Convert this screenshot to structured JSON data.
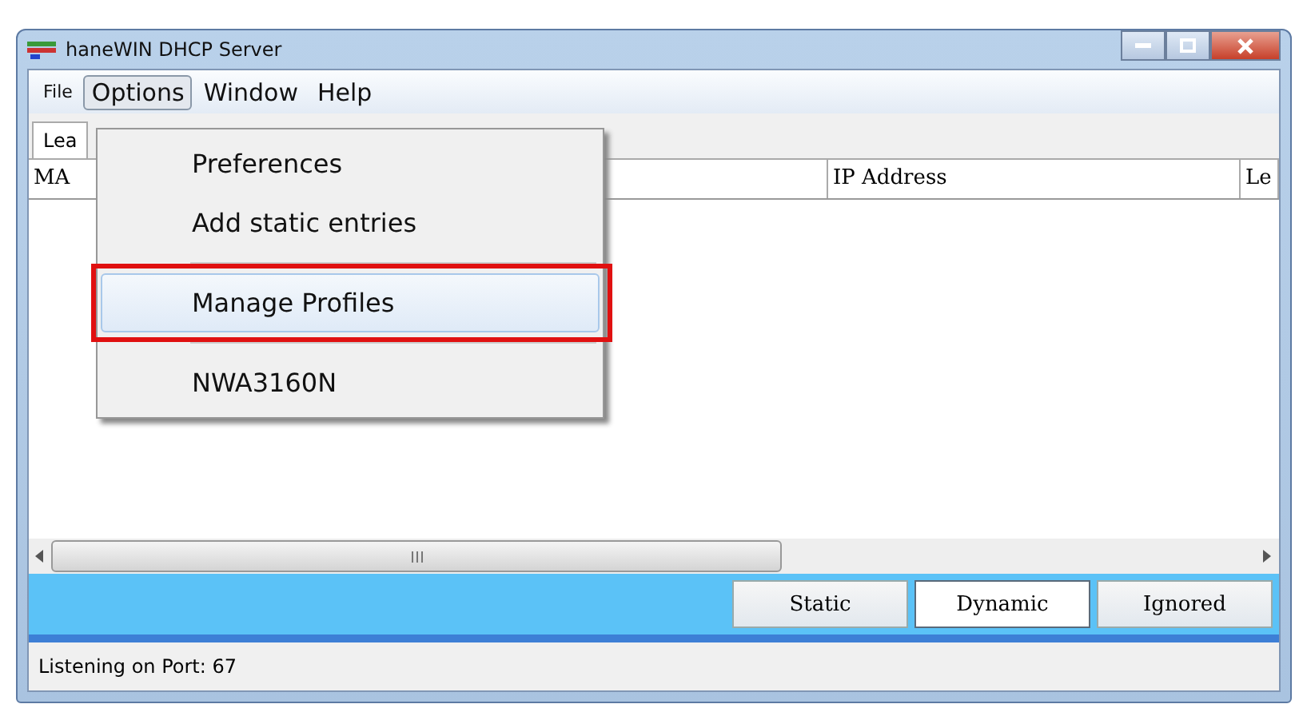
{
  "window": {
    "title": "haneWIN DHCP Server"
  },
  "menu_bar": [
    {
      "label": "File",
      "selected": false
    },
    {
      "label": "Options",
      "selected": true
    },
    {
      "label": "Window",
      "selected": false
    },
    {
      "label": "Help",
      "selected": false
    }
  ],
  "tabs": [
    {
      "label": "Lea",
      "selected": true
    }
  ],
  "table": {
    "columns": [
      "MA",
      "IP Address",
      "Le"
    ]
  },
  "dropdown": {
    "items": [
      {
        "kind": "item",
        "label": "Preferences",
        "highlighted": false
      },
      {
        "kind": "item",
        "label": "Add static entries",
        "highlighted": false
      },
      {
        "kind": "separator"
      },
      {
        "kind": "item",
        "label": "Manage Profiles",
        "highlighted": true
      },
      {
        "kind": "separator"
      },
      {
        "kind": "item",
        "label": "NWA3160N",
        "highlighted": false
      }
    ]
  },
  "filter_buttons": [
    {
      "label": "Static",
      "selected": false
    },
    {
      "label": "Dynamic",
      "selected": true
    },
    {
      "label": "Ignored",
      "selected": false
    }
  ],
  "status_bar": "Listening on Port: 67"
}
